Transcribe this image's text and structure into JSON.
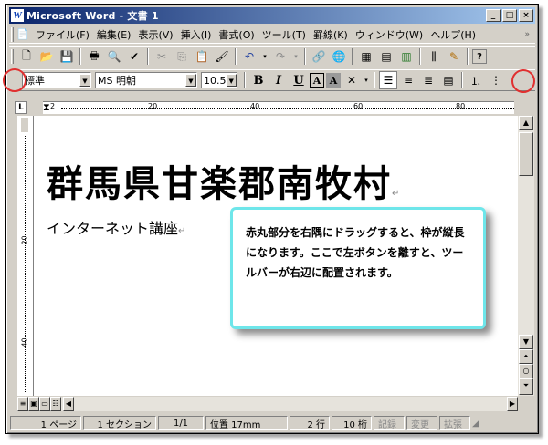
{
  "window": {
    "title": "Microsoft Word - 文書 1",
    "app_icon": "W",
    "caption_buttons": [
      "_",
      "□",
      "×"
    ]
  },
  "menubar": {
    "items": [
      "ファイル(F)",
      "編集(E)",
      "表示(V)",
      "挿入(I)",
      "書式(O)",
      "ツール(T)",
      "罫線(K)",
      "ウィンドウ(W)",
      "ヘルプ(H)"
    ],
    "more": "»"
  },
  "standard_toolbar": {
    "icons": [
      "new-doc-icon",
      "open-folder-icon",
      "save-icon",
      "print-icon",
      "print-preview-icon",
      "spellcheck-icon",
      "cut-icon",
      "copy-icon",
      "paste-icon",
      "format-painter-icon",
      "undo-icon",
      "redo-icon",
      "hyperlink-icon",
      "web-toolbar-icon",
      "tables-borders-icon",
      "insert-table-icon",
      "insert-excel-icon",
      "columns-icon",
      "drawing-icon",
      "help-icon"
    ],
    "help_label": "?"
  },
  "formatting_toolbar": {
    "style": "標準",
    "font": "MS 明朝",
    "size": "10.5",
    "bold": "B",
    "italic": "I",
    "underline": "U",
    "char_border": "A",
    "char_shading": "A"
  },
  "ruler": {
    "tab_selector": "L",
    "marks": [
      "2",
      "20",
      "40",
      "60",
      "80"
    ],
    "vertical_marks": [
      "20",
      "40"
    ]
  },
  "document": {
    "line1": "群馬県甘楽郡南牧村",
    "line2": "インターネット講座",
    "paragraph_mark": "↵"
  },
  "callout": {
    "text": "赤丸部分を右隅にドラッグすると、枠が縦長になります。ここで左ボタンを離すと、ツールバーが右辺に配置されます。"
  },
  "statusbar": {
    "page": "1 ページ",
    "section": "1 セクション",
    "page_of": "1/1",
    "position": "位置 17mm",
    "line": "2 行",
    "column": "10 桁",
    "rec": "記録",
    "trk": "変更",
    "ext": "拡張"
  },
  "colors": {
    "titlebar_start": "#0a246a",
    "titlebar_end": "#a6caf0",
    "callout_border": "#6ee6ea",
    "highlight_circle": "#e03030"
  }
}
